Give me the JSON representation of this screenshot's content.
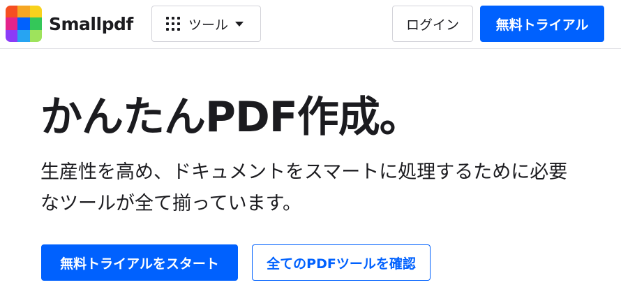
{
  "header": {
    "brand": "Smallpdf",
    "logo_colors": [
      "#f54f21",
      "#f5a623",
      "#f8d21c",
      "#e4238a",
      "#0061fe",
      "#34c759",
      "#8b3cf7",
      "#27a4f2",
      "#9ee35c"
    ],
    "tools_label": "ツール",
    "login_label": "ログイン",
    "trial_label": "無料トライアル"
  },
  "hero": {
    "title": "かんたんPDF作成。",
    "subtitle": "生産性を高め、ドキュメントをスマートに処理するために必要なツールが全て揃っています。",
    "primary_cta": "無料トライアルをスタート",
    "secondary_cta": "全てのPDFツールを確認"
  },
  "colors": {
    "accent": "#0061fe",
    "text": "#1b1b1f"
  }
}
